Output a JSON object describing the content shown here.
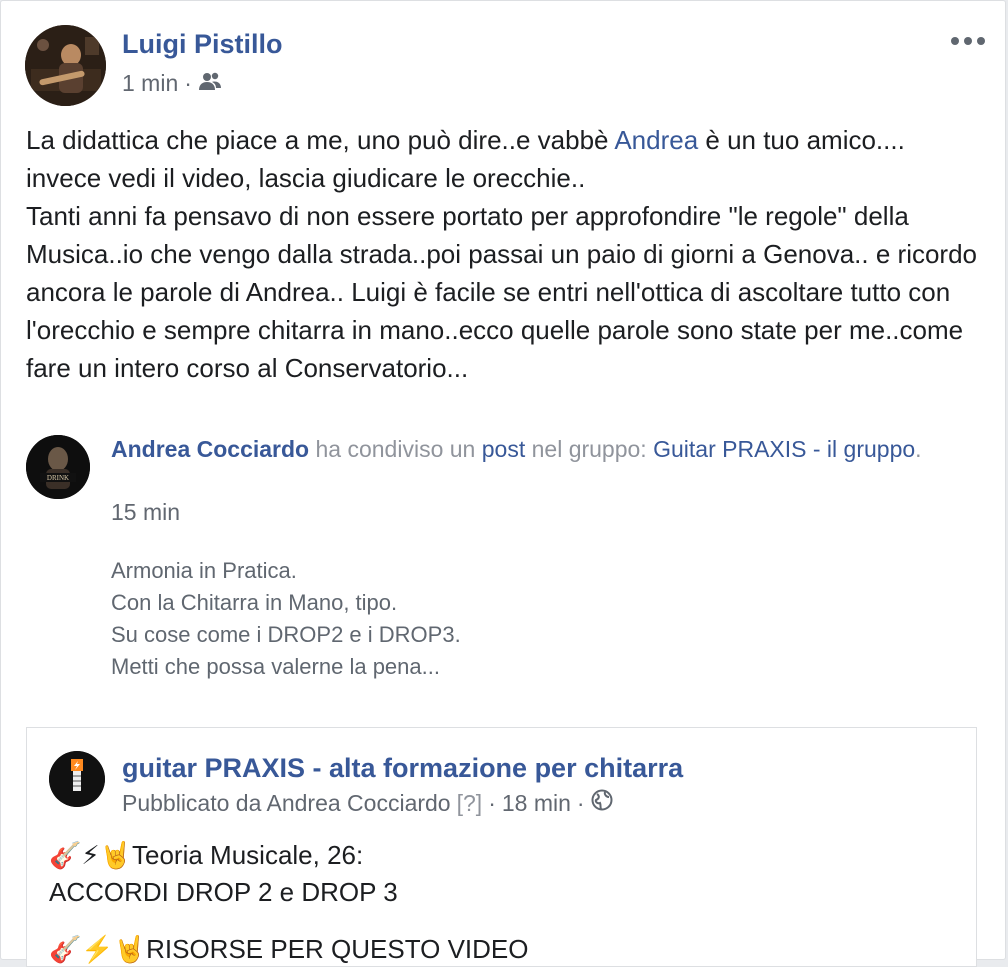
{
  "post": {
    "author": "Luigi Pistillo",
    "time": "1 min",
    "meta_separator": "·",
    "audience_icon": "friends-icon",
    "more_icon": "more-options-icon",
    "text_before_mention": "La didattica che piace a me, uno può dire..e vabbè ",
    "mention": "Andrea",
    "text_after_mention": " è un tuo amico.... invece vedi il video, lascia giudicare le orecchie..",
    "text_paragraph_2": "Tanti anni fa pensavo di non essere portato per approfondire \"le regole\" della Musica..io che vengo dalla strada..poi passai un paio di giorni a Genova.. e ricordo ancora le parole di Andrea.. Luigi è facile se entri nell'ottica di ascoltare tutto con l'orecchio e sempre chitarra in mano..ecco quelle parole sono state per me..come fare un intero corso al Conservatorio..."
  },
  "shared": {
    "author": "Andrea Cocciardo",
    "action": " ha condiviso un ",
    "post_link": "post",
    "in_group": " nel gruppo: ",
    "group_name": "Guitar PRAXIS - il gruppo",
    "period": ".",
    "time": "15 min",
    "lines": [
      "Armonia in Pratica.",
      "Con la Chitarra in Mano, tipo.",
      "Su cose come i DROP2 e i DROP3.",
      "Metti che possa valerne la pena..."
    ]
  },
  "original": {
    "page_name": "guitar PRAXIS - alta formazione per chitarra",
    "published_by": "Pubblicato da Andrea Cocciardo",
    "help": "[?]",
    "separator": "·",
    "time": "18 min",
    "visibility_icon": "globe-icon",
    "emoji_prefix": "🎸⚡🤘",
    "line_1": "Teoria Musicale, 26:",
    "line_2": "ACCORDI DROP 2 e DROP 3",
    "cut_line": "🎸⚡🤘RISORSE PER QUESTO VIDEO"
  },
  "colors": {
    "link": "#385898",
    "text": "#1c1e21",
    "meta": "#616770",
    "background": "#e9ebee"
  }
}
